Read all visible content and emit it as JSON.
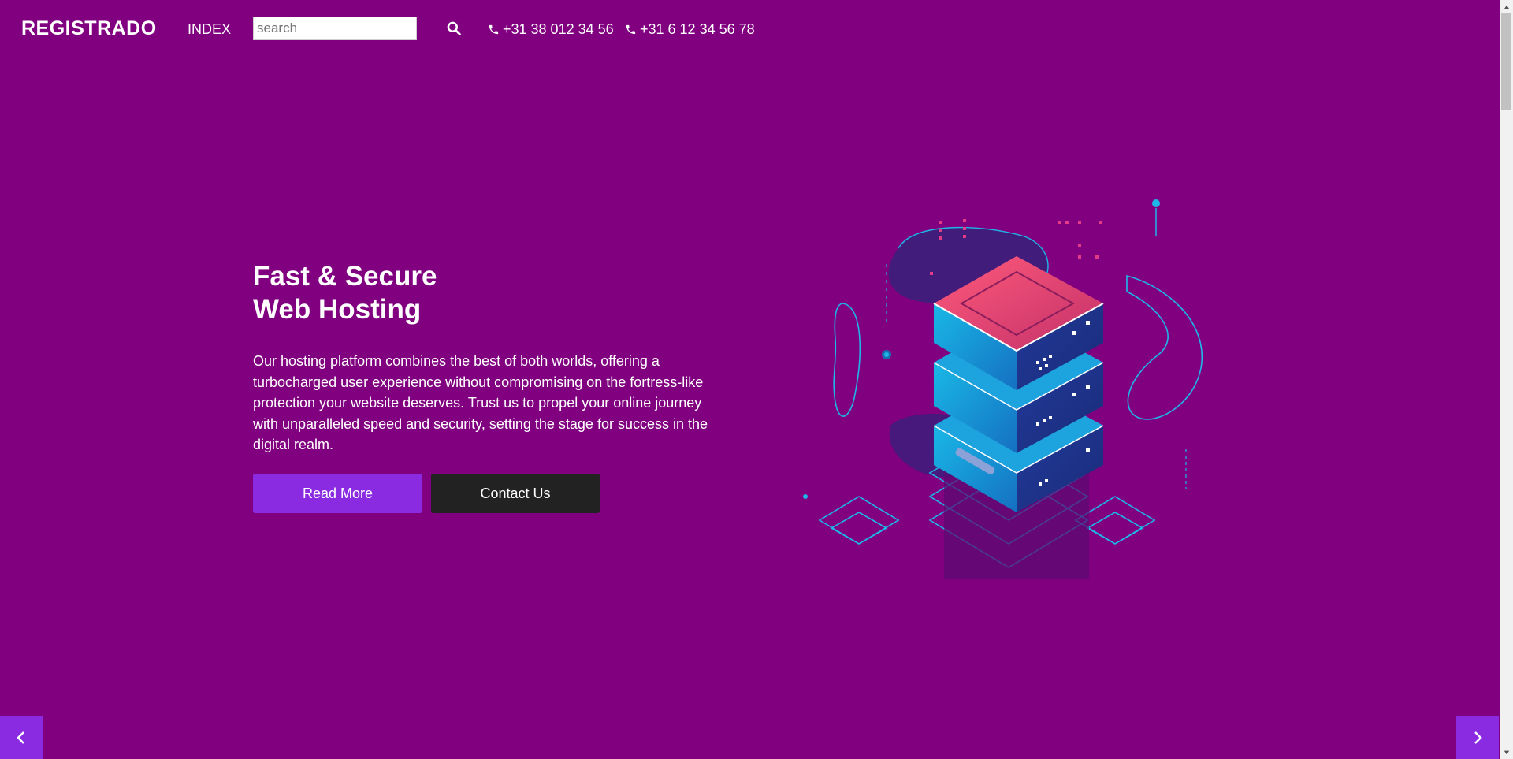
{
  "header": {
    "brand": "REGISTRADO",
    "nav_index": "INDEX",
    "search": {
      "placeholder": "search",
      "value": ""
    },
    "search_icon": "search-icon",
    "phones": [
      {
        "icon": "phone-icon",
        "number": "+31 38 012 34 56"
      },
      {
        "icon": "phone-icon",
        "number": "+31 6 12 34 56 78"
      }
    ]
  },
  "hero": {
    "title_line1": "Fast & Secure",
    "title_line2": "Web Hosting",
    "text": "Our hosting platform combines the best of both worlds, offering a turbocharged user experience without compromising on the fortress-like protection your website deserves. Trust us to propel your online journey with unparalleled speed and security, setting the stage for success in the digital realm.",
    "read_more": "Read More",
    "contact_us": "Contact Us",
    "illustration": "isometric-server-stack-illustration"
  },
  "carousel": {
    "prev_icon": "chevron-left-icon",
    "next_icon": "chevron-right-icon"
  },
  "colors": {
    "background": "#800080",
    "primary_button": "#8a2be2",
    "dark_button": "#222222",
    "text": "#ffffff"
  }
}
